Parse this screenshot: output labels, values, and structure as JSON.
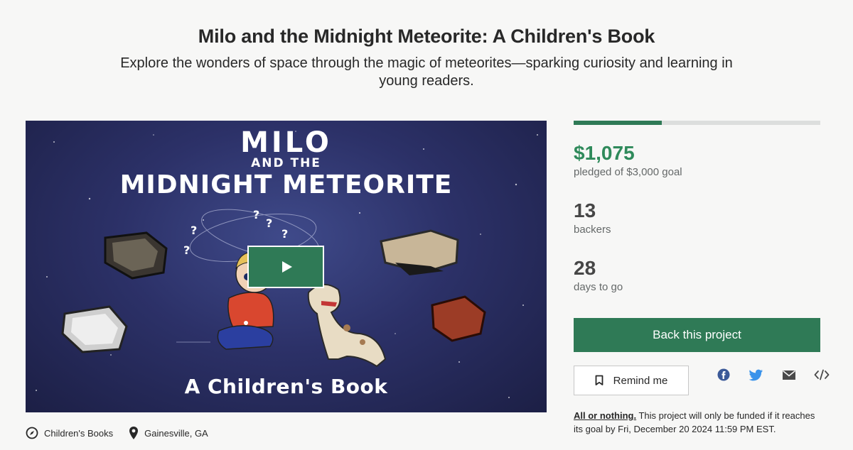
{
  "project": {
    "title": "Milo and the Midnight Meteorite: A Children's Book",
    "subtitle": "Explore the wonders of space through the magic of meteorites—sparking curiosity and learning in young readers."
  },
  "video": {
    "cover_title_line1": "MILO",
    "cover_title_line2": "AND THE",
    "cover_title_line3": "MIDNIGHT METEORITE",
    "cover_bottom": "A Children's Book",
    "play_icon": "play-icon"
  },
  "meta": {
    "category": "Children's Books",
    "category_icon": "compass-icon",
    "location": "Gainesville, GA",
    "location_icon": "map-pin-icon"
  },
  "funding": {
    "progress_fraction": 0.358,
    "pledged": "$1,075",
    "pledged_sub": "pledged of $3,000 goal",
    "backers_count": "13",
    "backers_label": "backers",
    "days_count": "28",
    "days_label": "days to go"
  },
  "actions": {
    "back_label": "Back this project",
    "remind_label": "Remind me",
    "share_icons": [
      "facebook-icon",
      "twitter-icon",
      "email-icon",
      "embed-icon"
    ]
  },
  "notice": {
    "aon_link": "All or nothing.",
    "aon_text": " This project will only be funded if it reaches its goal by Fri, December 20 2024 11:59 PM EST."
  },
  "colors": {
    "brand_green": "#2f7a56",
    "pledged_green": "#2f8a5b",
    "progress_track": "#dcdedd"
  }
}
